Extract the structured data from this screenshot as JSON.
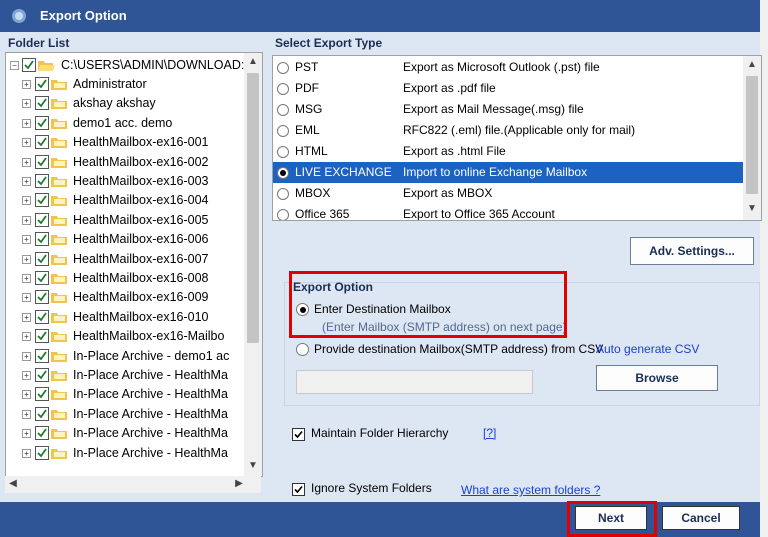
{
  "window": {
    "title": "Export Option"
  },
  "folder_list": {
    "heading": "Folder List",
    "root": "C:\\USERS\\ADMIN\\DOWNLOAD:",
    "items": [
      "Administrator",
      "akshay akshay",
      "demo1 acc. demo",
      "HealthMailbox-ex16-001",
      "HealthMailbox-ex16-002",
      "HealthMailbox-ex16-003",
      "HealthMailbox-ex16-004",
      "HealthMailbox-ex16-005",
      "HealthMailbox-ex16-006",
      "HealthMailbox-ex16-007",
      "HealthMailbox-ex16-008",
      "HealthMailbox-ex16-009",
      "HealthMailbox-ex16-010",
      "HealthMailbox-ex16-Mailbo",
      "In-Place Archive - demo1 ac",
      "In-Place Archive - HealthMa",
      "In-Place Archive - HealthMa",
      "In-Place Archive - HealthMa",
      "In-Place Archive - HealthMa",
      "In-Place Archive - HealthMa"
    ]
  },
  "export_type": {
    "heading": "Select Export Type",
    "options": [
      {
        "name": "PST",
        "desc": "Export as Microsoft Outlook (.pst) file",
        "selected": false
      },
      {
        "name": "PDF",
        "desc": "Export as .pdf file",
        "selected": false
      },
      {
        "name": "MSG",
        "desc": "Export as Mail Message(.msg) file",
        "selected": false
      },
      {
        "name": "EML",
        "desc": "RFC822 (.eml) file.(Applicable only for mail)",
        "selected": false
      },
      {
        "name": "HTML",
        "desc": "Export as .html File",
        "selected": false
      },
      {
        "name": "LIVE EXCHANGE",
        "desc": "Import to online Exchange Mailbox",
        "selected": true
      },
      {
        "name": "MBOX",
        "desc": "Export as MBOX",
        "selected": false
      },
      {
        "name": "Office 365",
        "desc": "Export to Office 365 Account",
        "selected": false
      }
    ]
  },
  "adv_settings_label": "Adv. Settings...",
  "export_option": {
    "heading": "Export Option",
    "opt1_label": "Enter Destination Mailbox",
    "opt1_sub": "(Enter Mailbox (SMTP address) on next page)",
    "opt2_label": "Provide destination Mailbox(SMTP address) from CSV",
    "auto_csv": "Auto generate CSV",
    "browse_label": "Browse",
    "csv_path": ""
  },
  "maintain_hierarchy": {
    "label": "Maintain Folder Hierarchy",
    "help": "[?]",
    "checked": true
  },
  "ignore_system": {
    "label": "Ignore System Folders",
    "link": "What are system folders ?",
    "checked": true
  },
  "buttons": {
    "next": "Next",
    "cancel": "Cancel"
  },
  "colors": {
    "title_bar": "#2f5597",
    "pane_bg": "#dde6f3",
    "selection": "#1b62c2",
    "highlight_border": "#e00000"
  }
}
